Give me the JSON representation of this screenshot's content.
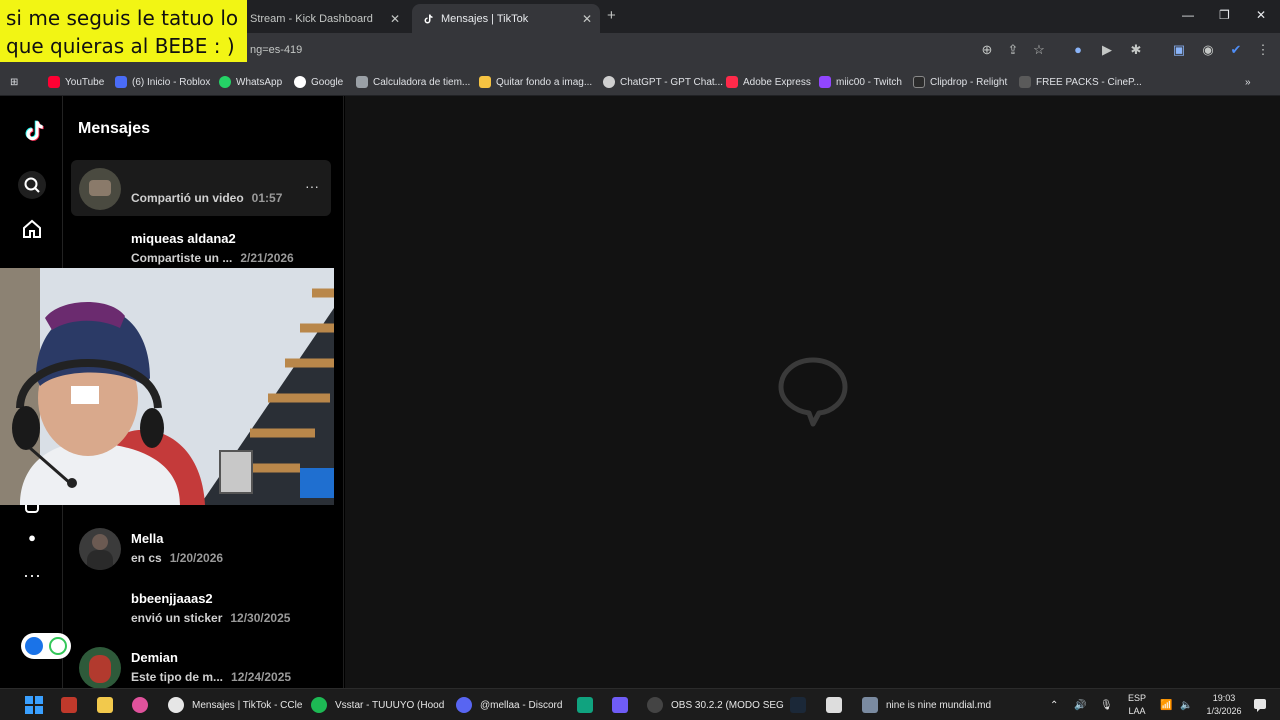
{
  "caption": {
    "line1": "si me seguis le tatuo lo",
    "line2": "que quieras al BEBE : )"
  },
  "browser": {
    "tabs": [
      {
        "title": "Stream - Kick Dashboard",
        "active": false
      },
      {
        "title": "Mensajes | TikTok",
        "active": true
      }
    ],
    "url": "ng=es-419",
    "bookmarks": [
      {
        "label": "YouTube",
        "color": "#ff0033"
      },
      {
        "label": "(6) Inicio - Roblox",
        "color": "#4a6cf7"
      },
      {
        "label": "WhatsApp",
        "color": "#25d366"
      },
      {
        "label": "Google",
        "color": "#ffffff"
      },
      {
        "label": "Calculadora de tiem...",
        "color": "#9aa0a6"
      },
      {
        "label": "Quitar fondo a imag...",
        "color": "#f6c342"
      },
      {
        "label": "ChatGPT - GPT Chat...",
        "color": "#cfcfcf"
      },
      {
        "label": "Adobe Express",
        "color": "#1f1f1f"
      },
      {
        "label": "miic00 - Twitch",
        "color": "#9146ff"
      },
      {
        "label": "Clipdrop - Relight",
        "color": "#2b2b2b"
      },
      {
        "label": "FREE PACKS - CineP...",
        "color": "#5a5a5a"
      }
    ]
  },
  "tiktok": {
    "title": "Mensajes",
    "conversations": [
      {
        "name": "",
        "preview": "Compartió un video",
        "time": "01:57",
        "active": true
      },
      {
        "name": "miqueas aldana2",
        "preview": "Compartiste un ...",
        "time": "2/21/2026",
        "active": false
      },
      {
        "name": "Mella",
        "preview": "en cs",
        "time": "1/20/2026",
        "active": false
      },
      {
        "name": "bbeenjjaaas2",
        "preview": "envió un sticker",
        "time": "12/30/2025",
        "active": false
      },
      {
        "name": "Demian",
        "preview": "Este tipo de m...",
        "time": "12/24/2025",
        "active": false
      }
    ]
  },
  "taskbar": {
    "apps": [
      {
        "label": "Mensajes | TikTok - CCle",
        "color": "#e6e6e6"
      },
      {
        "label": "Vsstar - TUUUYO (Hood",
        "color": "#1db954"
      },
      {
        "label": "@mellaa - Discord",
        "color": "#5865f2"
      },
      {
        "label": "OBS 30.2.2 (MODO SEG",
        "color": "#444444"
      },
      {
        "label": "nine is nine mundial.md",
        "color": "#7a8aa0"
      }
    ],
    "lang_line1": "ESP",
    "lang_line2": "LAA",
    "time": "19:03",
    "date": "1/3/2026"
  }
}
